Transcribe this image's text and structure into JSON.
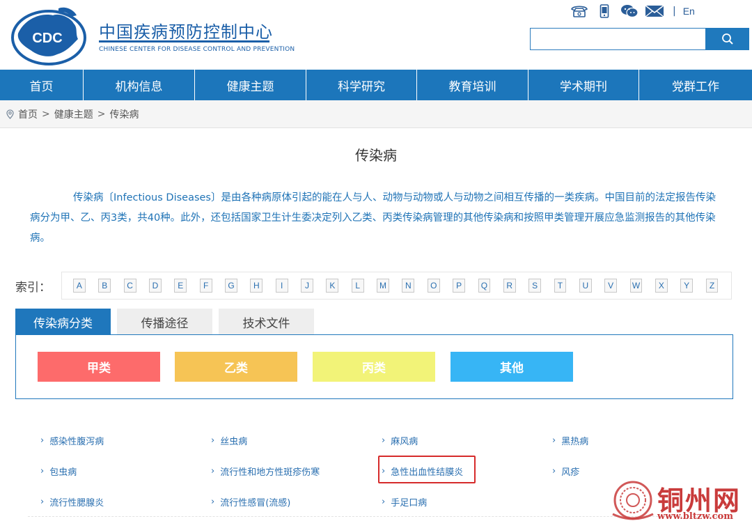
{
  "header": {
    "title": "中国疾病预防控制中心",
    "subtitle": "CHINESE CENTER FOR DISEASE CONTROL AND PREVENTION",
    "logo_text": "CDC",
    "icons": [
      "phone-icon",
      "mobile-icon",
      "wechat-icon",
      "mail-icon"
    ],
    "lang_separator": "|",
    "lang": "En",
    "search": {
      "placeholder": "",
      "value": ""
    }
  },
  "nav": {
    "items": [
      {
        "label": "首页"
      },
      {
        "label": "机构信息"
      },
      {
        "label": "健康主题"
      },
      {
        "label": "科学研究"
      },
      {
        "label": "教育培训"
      },
      {
        "label": "学术期刊"
      },
      {
        "label": "党群工作"
      }
    ]
  },
  "breadcrumb": {
    "items": [
      "首页",
      "健康主题",
      "传染病"
    ],
    "separator": ">"
  },
  "main": {
    "title": "传染病",
    "intro": "传染病〔Infectious Diseases〕是由各种病原体引起的能在人与人、动物与动物或人与动物之间相互传播的一类疾病。中国目前的法定报告传染病分为甲、乙、丙3类，共40种。此外，还包括国家卫生计生委决定列入乙类、丙类传染病管理的其他传染病和按照甲类管理开展应急监测报告的其他传染病。"
  },
  "index": {
    "label": "索引：",
    "letters": [
      "A",
      "B",
      "C",
      "D",
      "E",
      "F",
      "G",
      "H",
      "I",
      "J",
      "K",
      "L",
      "M",
      "N",
      "O",
      "P",
      "Q",
      "R",
      "S",
      "T",
      "U",
      "V",
      "W",
      "X",
      "Y",
      "Z"
    ]
  },
  "tabs": {
    "items": [
      "传染病分类",
      "传播途径",
      "技术文件"
    ],
    "active": 0
  },
  "categories": [
    {
      "label": "甲类",
      "color": "#fd6b6b"
    },
    {
      "label": "乙类",
      "color": "#f6c455"
    },
    {
      "label": "丙类",
      "color": "#f2f378"
    },
    {
      "label": "其他",
      "color": "#37b5f5"
    }
  ],
  "diseases": [
    "感染性腹泻病",
    "丝虫病",
    "麻风病",
    "黑热病",
    "包虫病",
    "流行性和地方性斑疹伤寒",
    "急性出血性结膜炎",
    "风疹",
    "流行性腮腺炎",
    "流行性感冒(流感)",
    "手足口病"
  ],
  "colors": {
    "brand": "#1c76bb",
    "link": "#2a6fb0",
    "highlight": "#d62a2a"
  },
  "watermark": {
    "text": "铜州网",
    "url": "www.bltzw.com"
  }
}
